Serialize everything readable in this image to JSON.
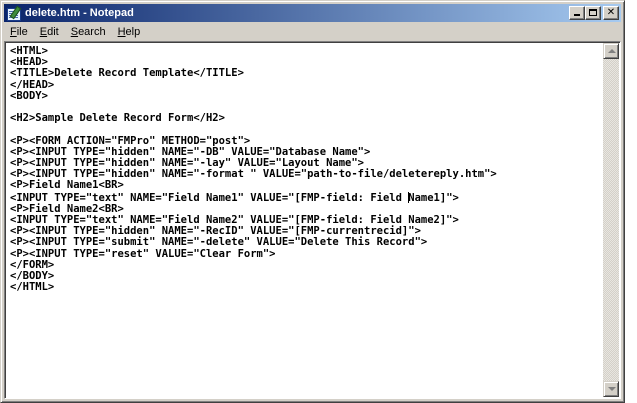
{
  "window": {
    "title": "delete.htm - Notepad",
    "colors": {
      "titlebar_start": "#0a246a",
      "titlebar_end": "#a6caf0",
      "face": "#d4d0c8"
    }
  },
  "menu": {
    "file": {
      "accel": "F",
      "rest": "ile"
    },
    "edit": {
      "accel": "E",
      "rest": "dit"
    },
    "search": {
      "accel": "S",
      "rest": "earch"
    },
    "help": {
      "accel": "H",
      "rest": "elp"
    }
  },
  "caption_buttons": {
    "minimize_icon": "minimize-icon",
    "maximize_icon": "maximize-icon",
    "close_icon": "close-icon",
    "close_glyph": "✕"
  },
  "editor": {
    "lines": [
      "<HTML>",
      "<HEAD>",
      "<TITLE>Delete Record Template</TITLE>",
      "</HEAD>",
      "<BODY>",
      "",
      "<H2>Sample Delete Record Form</H2>",
      "",
      "<P><FORM ACTION=\"FMPro\" METHOD=\"post\">",
      "<P><INPUT TYPE=\"hidden\" NAME=\"-DB\" VALUE=\"Database Name\">",
      "<P><INPUT TYPE=\"hidden\" NAME=\"-lay\" VALUE=\"Layout Name\">",
      "<P><INPUT TYPE=\"hidden\" NAME=\"-format \" VALUE=\"path-to-file/deletereply.htm\">",
      "<P>Field Name1<BR>",
      "<INPUT TYPE=\"text\" NAME=\"Field Name1\" VALUE=\"[FMP-field: Field Name1]\">",
      "<P>Field Name2<BR>",
      "<INPUT TYPE=\"text\" NAME=\"Field Name2\" VALUE=\"[FMP-field: Field Name2]\">",
      "<P><INPUT TYPE=\"hidden\" NAME=\"-RecID\" VALUE=\"[FMP-currentrecid]\">",
      "<P><INPUT TYPE=\"submit\" NAME=\"-delete\" VALUE=\"Delete This Record\">",
      "<P><INPUT TYPE=\"reset\" VALUE=\"Clear Form\">",
      "</FORM>",
      "</BODY>",
      "</HTML>"
    ],
    "caret_line_index": 13,
    "caret_before": "<INPUT TYPE=\"text\" NAME=\"Field Name1\" VALUE=\"[FMP-field: Field ",
    "caret_after": "Name1]\">"
  }
}
